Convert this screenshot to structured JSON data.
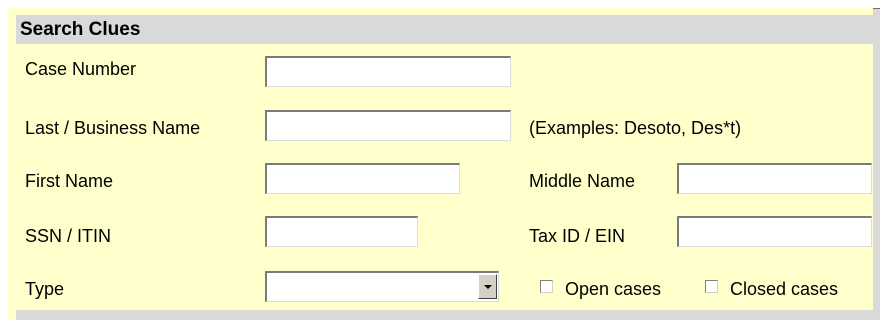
{
  "section": {
    "title": "Search Clues"
  },
  "fields": {
    "case_number": {
      "label": "Case Number",
      "value": ""
    },
    "last_business_name": {
      "label": "Last / Business Name",
      "value": "",
      "hint": "(Examples: Desoto, Des*t)"
    },
    "first_name": {
      "label": "First Name",
      "value": ""
    },
    "middle_name": {
      "label": "Middle Name",
      "value": ""
    },
    "ssn_itin": {
      "label": "SSN / ITIN",
      "value": ""
    },
    "tax_id_ein": {
      "label": "Tax ID / EIN",
      "value": ""
    },
    "type": {
      "label": "Type",
      "selected": ""
    }
  },
  "checkboxes": {
    "open_cases": {
      "label": "Open cases",
      "checked": false
    },
    "closed_cases": {
      "label": "Closed cases",
      "checked": false
    }
  },
  "colors": {
    "panel": "#ffffcc",
    "header": "#d9d9d9"
  }
}
